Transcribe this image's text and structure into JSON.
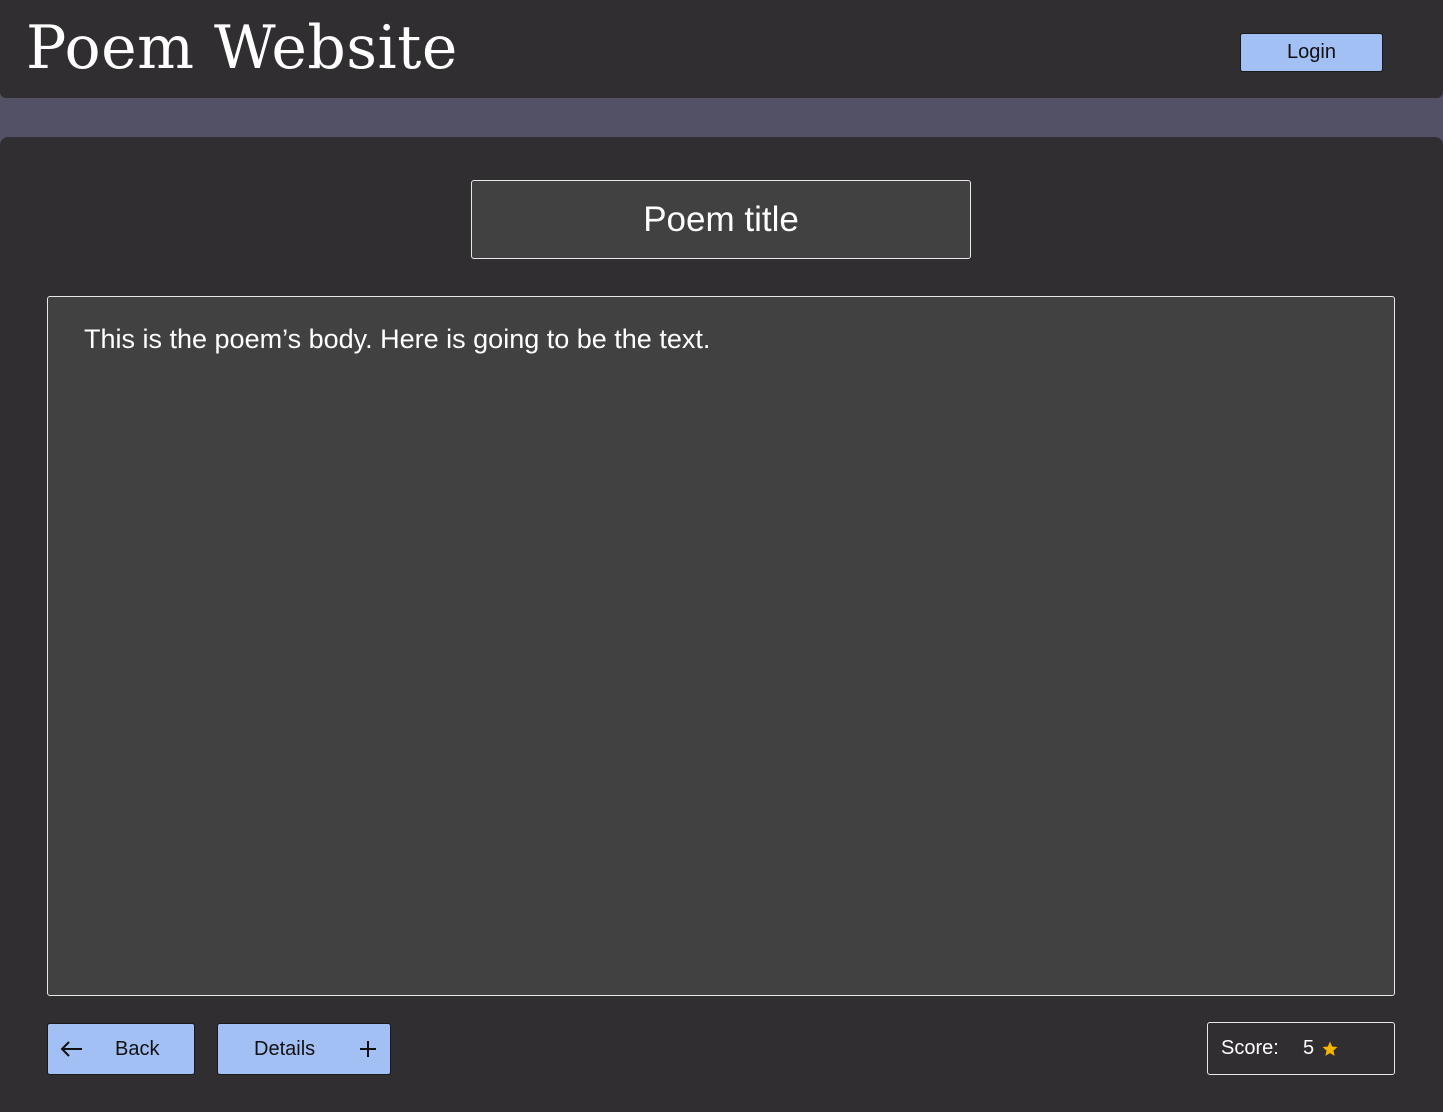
{
  "header": {
    "site_title": "Poem Website",
    "login_label": "Login"
  },
  "poem": {
    "title": "Poem title",
    "body": "This is the poem’s body. Here is going to be the text."
  },
  "footer": {
    "back_label": "Back",
    "back_icon": "arrow-left-icon",
    "details_label": "Details",
    "details_icon": "plus-icon",
    "score_label": "Score:",
    "score_value": "5",
    "score_icon": "star-icon"
  },
  "colors": {
    "header_bg": "#302e30",
    "page_band": "#525166",
    "panel_bg": "#414141",
    "button_accent": "#a3c0f5",
    "star": "#f5b400"
  }
}
